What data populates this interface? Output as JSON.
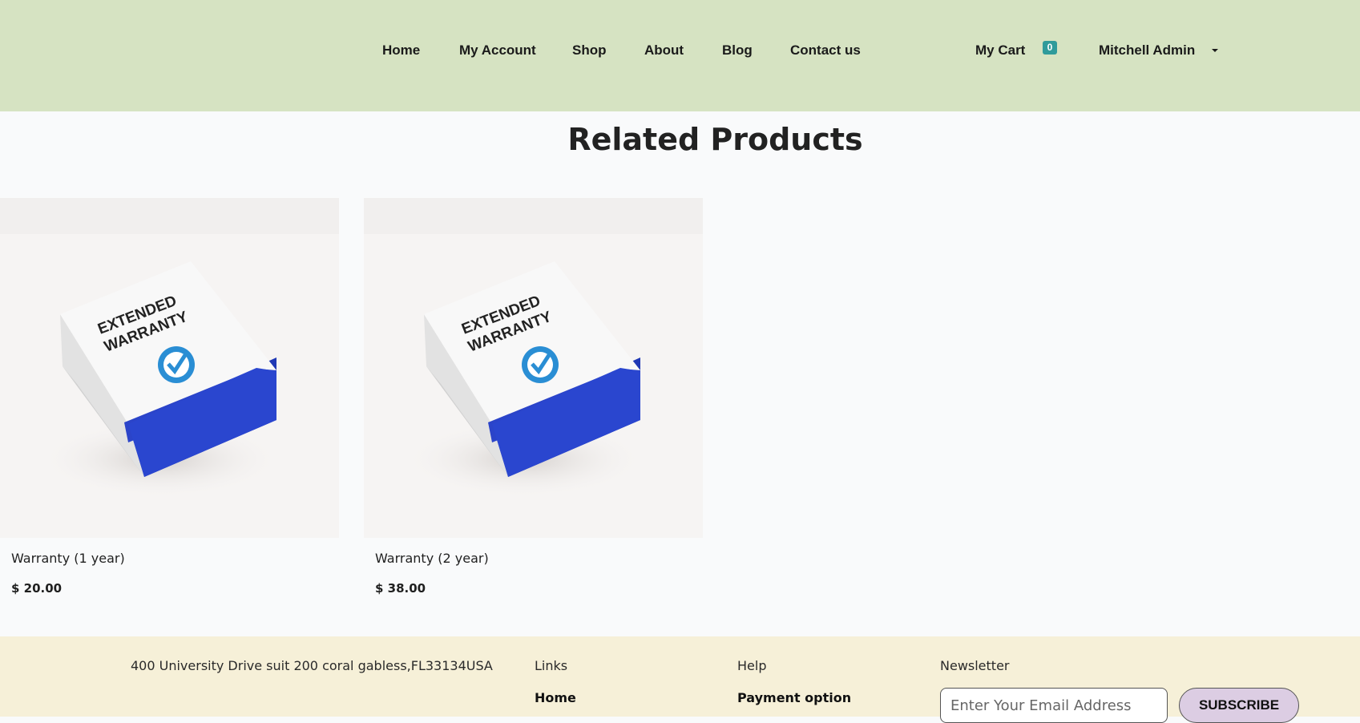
{
  "header": {
    "nav": [
      "Home",
      "My Account",
      "Shop",
      "About",
      "Blog",
      "Contact us"
    ],
    "cart_label": "My Cart",
    "cart_count": "0",
    "user_name": "Mitchell Admin"
  },
  "main": {
    "section_title": "Related Products",
    "products": [
      {
        "name": "Warranty (1 year)",
        "price": "$ 20.00",
        "box_text_1": "EXTENDED",
        "box_text_2": "WARRANTY"
      },
      {
        "name": "Warranty (2 year)",
        "price": "$ 38.00",
        "box_text_1": "EXTENDED",
        "box_text_2": "WARRANTY"
      }
    ]
  },
  "footer": {
    "address": "400 University Drive suit 200 coral gabless,FL33134USA",
    "links_heading": "Links",
    "links_first": "Home",
    "help_heading": "Help",
    "help_first": "Payment option",
    "newsletter_heading": "Newsletter",
    "email_placeholder": "Enter Your Email Address",
    "subscribe_label": "SUBSCRIBE"
  },
  "colors": {
    "header_bg": "#d6e3c2",
    "footer_bg": "#f6f0d8",
    "badge": "#2f9b9b",
    "subscribe_bg": "#dccde3",
    "box_blue": "#2b44c9"
  }
}
